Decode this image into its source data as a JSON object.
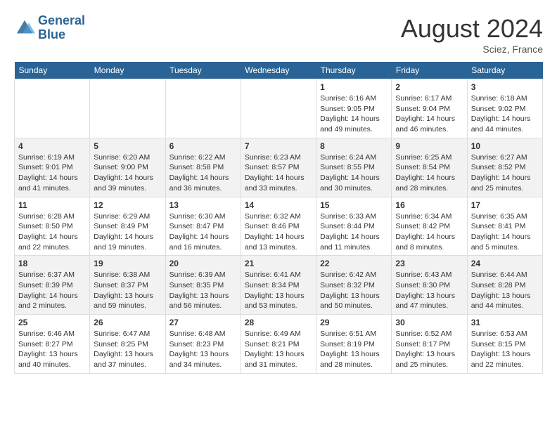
{
  "header": {
    "logo_line1": "General",
    "logo_line2": "Blue",
    "month_year": "August 2024",
    "location": "Sciez, France"
  },
  "weekdays": [
    "Sunday",
    "Monday",
    "Tuesday",
    "Wednesday",
    "Thursday",
    "Friday",
    "Saturday"
  ],
  "weeks": [
    [
      {
        "day": "",
        "info": ""
      },
      {
        "day": "",
        "info": ""
      },
      {
        "day": "",
        "info": ""
      },
      {
        "day": "",
        "info": ""
      },
      {
        "day": "1",
        "info": "Sunrise: 6:16 AM\nSunset: 9:05 PM\nDaylight: 14 hours and 49 minutes."
      },
      {
        "day": "2",
        "info": "Sunrise: 6:17 AM\nSunset: 9:04 PM\nDaylight: 14 hours and 46 minutes."
      },
      {
        "day": "3",
        "info": "Sunrise: 6:18 AM\nSunset: 9:02 PM\nDaylight: 14 hours and 44 minutes."
      }
    ],
    [
      {
        "day": "4",
        "info": "Sunrise: 6:19 AM\nSunset: 9:01 PM\nDaylight: 14 hours and 41 minutes."
      },
      {
        "day": "5",
        "info": "Sunrise: 6:20 AM\nSunset: 9:00 PM\nDaylight: 14 hours and 39 minutes."
      },
      {
        "day": "6",
        "info": "Sunrise: 6:22 AM\nSunset: 8:58 PM\nDaylight: 14 hours and 36 minutes."
      },
      {
        "day": "7",
        "info": "Sunrise: 6:23 AM\nSunset: 8:57 PM\nDaylight: 14 hours and 33 minutes."
      },
      {
        "day": "8",
        "info": "Sunrise: 6:24 AM\nSunset: 8:55 PM\nDaylight: 14 hours and 30 minutes."
      },
      {
        "day": "9",
        "info": "Sunrise: 6:25 AM\nSunset: 8:54 PM\nDaylight: 14 hours and 28 minutes."
      },
      {
        "day": "10",
        "info": "Sunrise: 6:27 AM\nSunset: 8:52 PM\nDaylight: 14 hours and 25 minutes."
      }
    ],
    [
      {
        "day": "11",
        "info": "Sunrise: 6:28 AM\nSunset: 8:50 PM\nDaylight: 14 hours and 22 minutes."
      },
      {
        "day": "12",
        "info": "Sunrise: 6:29 AM\nSunset: 8:49 PM\nDaylight: 14 hours and 19 minutes."
      },
      {
        "day": "13",
        "info": "Sunrise: 6:30 AM\nSunset: 8:47 PM\nDaylight: 14 hours and 16 minutes."
      },
      {
        "day": "14",
        "info": "Sunrise: 6:32 AM\nSunset: 8:46 PM\nDaylight: 14 hours and 13 minutes."
      },
      {
        "day": "15",
        "info": "Sunrise: 6:33 AM\nSunset: 8:44 PM\nDaylight: 14 hours and 11 minutes."
      },
      {
        "day": "16",
        "info": "Sunrise: 6:34 AM\nSunset: 8:42 PM\nDaylight: 14 hours and 8 minutes."
      },
      {
        "day": "17",
        "info": "Sunrise: 6:35 AM\nSunset: 8:41 PM\nDaylight: 14 hours and 5 minutes."
      }
    ],
    [
      {
        "day": "18",
        "info": "Sunrise: 6:37 AM\nSunset: 8:39 PM\nDaylight: 14 hours and 2 minutes."
      },
      {
        "day": "19",
        "info": "Sunrise: 6:38 AM\nSunset: 8:37 PM\nDaylight: 13 hours and 59 minutes."
      },
      {
        "day": "20",
        "info": "Sunrise: 6:39 AM\nSunset: 8:35 PM\nDaylight: 13 hours and 56 minutes."
      },
      {
        "day": "21",
        "info": "Sunrise: 6:41 AM\nSunset: 8:34 PM\nDaylight: 13 hours and 53 minutes."
      },
      {
        "day": "22",
        "info": "Sunrise: 6:42 AM\nSunset: 8:32 PM\nDaylight: 13 hours and 50 minutes."
      },
      {
        "day": "23",
        "info": "Sunrise: 6:43 AM\nSunset: 8:30 PM\nDaylight: 13 hours and 47 minutes."
      },
      {
        "day": "24",
        "info": "Sunrise: 6:44 AM\nSunset: 8:28 PM\nDaylight: 13 hours and 44 minutes."
      }
    ],
    [
      {
        "day": "25",
        "info": "Sunrise: 6:46 AM\nSunset: 8:27 PM\nDaylight: 13 hours and 40 minutes."
      },
      {
        "day": "26",
        "info": "Sunrise: 6:47 AM\nSunset: 8:25 PM\nDaylight: 13 hours and 37 minutes."
      },
      {
        "day": "27",
        "info": "Sunrise: 6:48 AM\nSunset: 8:23 PM\nDaylight: 13 hours and 34 minutes."
      },
      {
        "day": "28",
        "info": "Sunrise: 6:49 AM\nSunset: 8:21 PM\nDaylight: 13 hours and 31 minutes."
      },
      {
        "day": "29",
        "info": "Sunrise: 6:51 AM\nSunset: 8:19 PM\nDaylight: 13 hours and 28 minutes."
      },
      {
        "day": "30",
        "info": "Sunrise: 6:52 AM\nSunset: 8:17 PM\nDaylight: 13 hours and 25 minutes."
      },
      {
        "day": "31",
        "info": "Sunrise: 6:53 AM\nSunset: 8:15 PM\nDaylight: 13 hours and 22 minutes."
      }
    ]
  ]
}
